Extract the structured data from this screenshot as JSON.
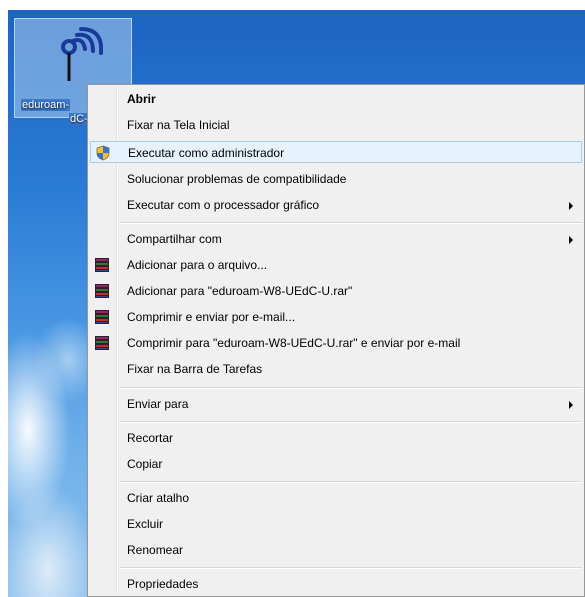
{
  "desktop": {
    "icon": {
      "name": "wifi-shortcut-icon",
      "label_line1": "eduroam-",
      "label_line1_tail": "",
      "label_line2": "dC-U"
    }
  },
  "menu": {
    "items": [
      {
        "label": "Abrir",
        "bold": true
      },
      {
        "label": "Fixar na Tela Inicial"
      },
      {
        "label": "Executar como administrador",
        "icon": "shield-icon",
        "hover": true
      },
      {
        "label": "Solucionar problemas de compatibilidade"
      },
      {
        "label": "Executar com o processador gráfico",
        "submenu": true
      },
      {
        "label": "Compartilhar com",
        "submenu": true
      },
      {
        "label": "Adicionar para o arquivo...",
        "icon": "winrar-icon"
      },
      {
        "label": "Adicionar para \"eduroam-W8-UEdC-U.rar\"",
        "icon": "winrar-icon"
      },
      {
        "label": "Comprimir e enviar por e-mail...",
        "icon": "winrar-icon"
      },
      {
        "label": "Comprimir para \"eduroam-W8-UEdC-U.rar\" e enviar por e-mail",
        "icon": "winrar-icon"
      },
      {
        "label": "Fixar na Barra de Tarefas"
      },
      {
        "label": "Enviar para",
        "submenu": true
      },
      {
        "label": "Recortar"
      },
      {
        "label": "Copiar"
      },
      {
        "label": "Criar atalho"
      },
      {
        "label": "Excluir"
      },
      {
        "label": "Renomear"
      },
      {
        "label": "Propriedades"
      }
    ]
  },
  "colors": {
    "menu_bg": "#f0f0f0",
    "hover_bg": "#e5f1fb",
    "hover_border": "#a8caec",
    "desktop_blue": "#2a7bd6"
  }
}
